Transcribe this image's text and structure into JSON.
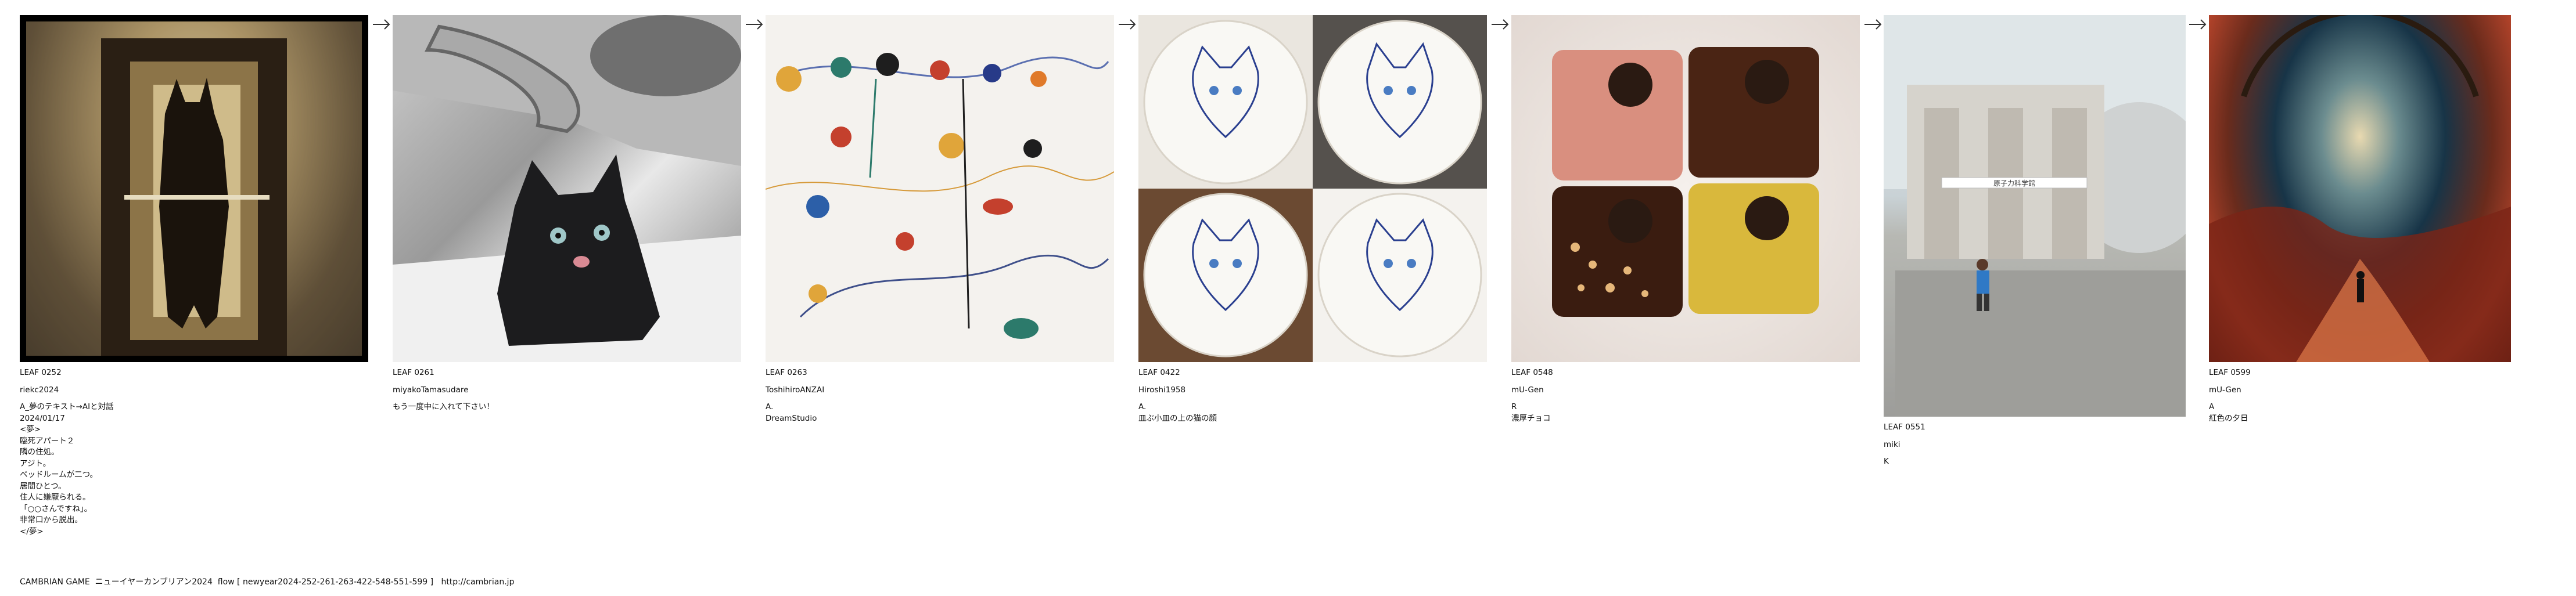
{
  "leaves": [
    {
      "id": "LEAF 0252",
      "author": "riekc2024",
      "lines": [
        "A_夢のテキスト→AIと対話",
        "2024/01/17",
        "<夢>",
        "臨死アパート２",
        "隣の住処。",
        "アジト。",
        "ベッドルームが二つ。",
        "居間ひとつ。",
        "住人に嫌厭られる。",
        "「○○さんですね」。",
        "非常口から脱出。",
        "</夢>"
      ]
    },
    {
      "id": "LEAF 0261",
      "author": "miyakoTamasudare",
      "lines": [
        "もう一度中に入れて下さい！"
      ]
    },
    {
      "id": "LEAF 0263",
      "author": "ToshihiroANZAI",
      "lines": [
        "A.",
        "DreamStudio"
      ]
    },
    {
      "id": "LEAF 0422",
      "author": "Hiroshi1958",
      "lines": [
        "A.",
        "皿ぶ小皿の上の猫の顔"
      ]
    },
    {
      "id": "LEAF 0548",
      "author": "mU-Gen",
      "lines": [
        "R",
        "濃厚チョコ"
      ]
    },
    {
      "id": "LEAF 0551",
      "author": "miki",
      "lines": [
        "K"
      ]
    },
    {
      "id": "LEAF 0599",
      "author": "mU-Gen",
      "lines": [
        "A",
        "紅色の夕日"
      ]
    }
  ],
  "footer": "CAMBRIAN GAME  ニューイヤーカンブリアン2024  flow [ newyear2024-252-261-263-422-548-551-599 ]   http://cambrian.jp",
  "banner_text": "原子力科学館"
}
